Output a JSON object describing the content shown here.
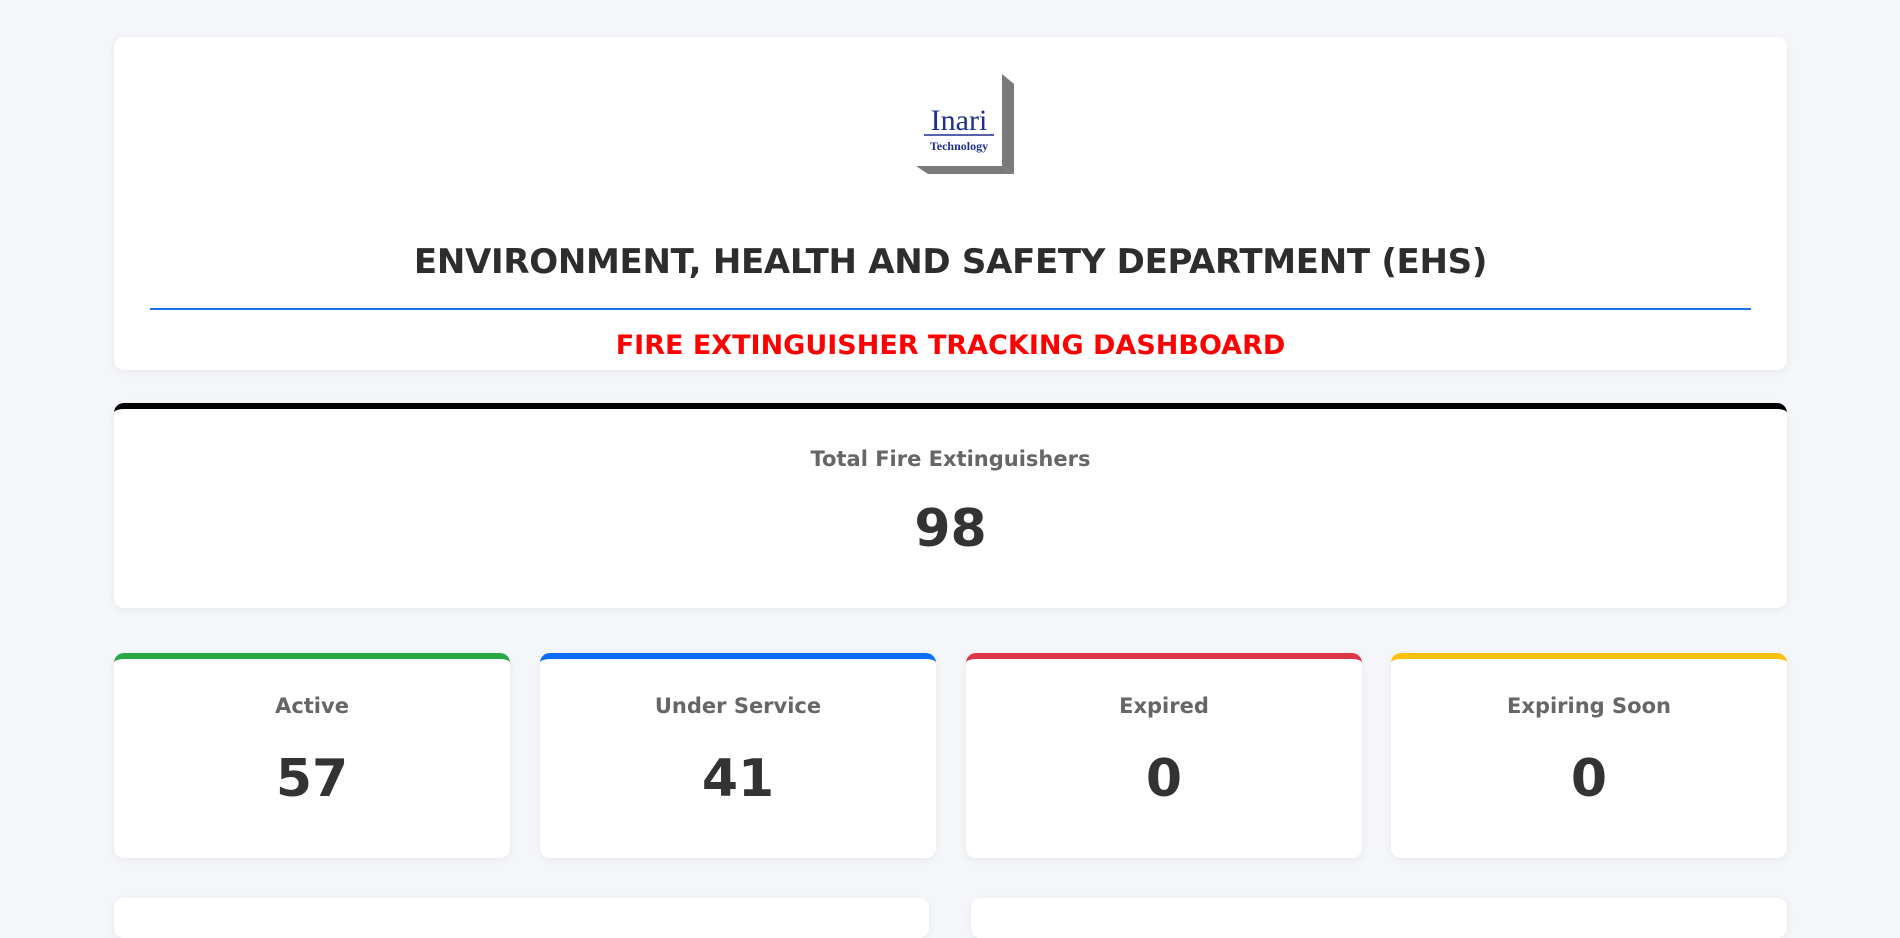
{
  "header": {
    "logo": {
      "name": "Inari",
      "subtitle": "Technology"
    },
    "department_title": "ENVIRONMENT, HEALTH AND SAFETY DEPARTMENT (EHS)",
    "dashboard_title": "FIRE EXTINGUISHER TRACKING DASHBOARD"
  },
  "total": {
    "label": "Total Fire Extinguishers",
    "value": "98"
  },
  "status_cards": {
    "active": {
      "label": "Active",
      "value": "57",
      "color": "#28a745"
    },
    "under_service": {
      "label": "Under Service",
      "value": "41",
      "color": "#0d6efd"
    },
    "expired": {
      "label": "Expired",
      "value": "0",
      "color": "#dc3545"
    },
    "expiring_soon": {
      "label": "Expiring Soon",
      "value": "0",
      "color": "#ffc107"
    }
  },
  "colors": {
    "background": "#f4f6f9",
    "accent_divider": "#1a73e8",
    "dashboard_title": "#ff0000",
    "total_top_border": "#000000"
  }
}
